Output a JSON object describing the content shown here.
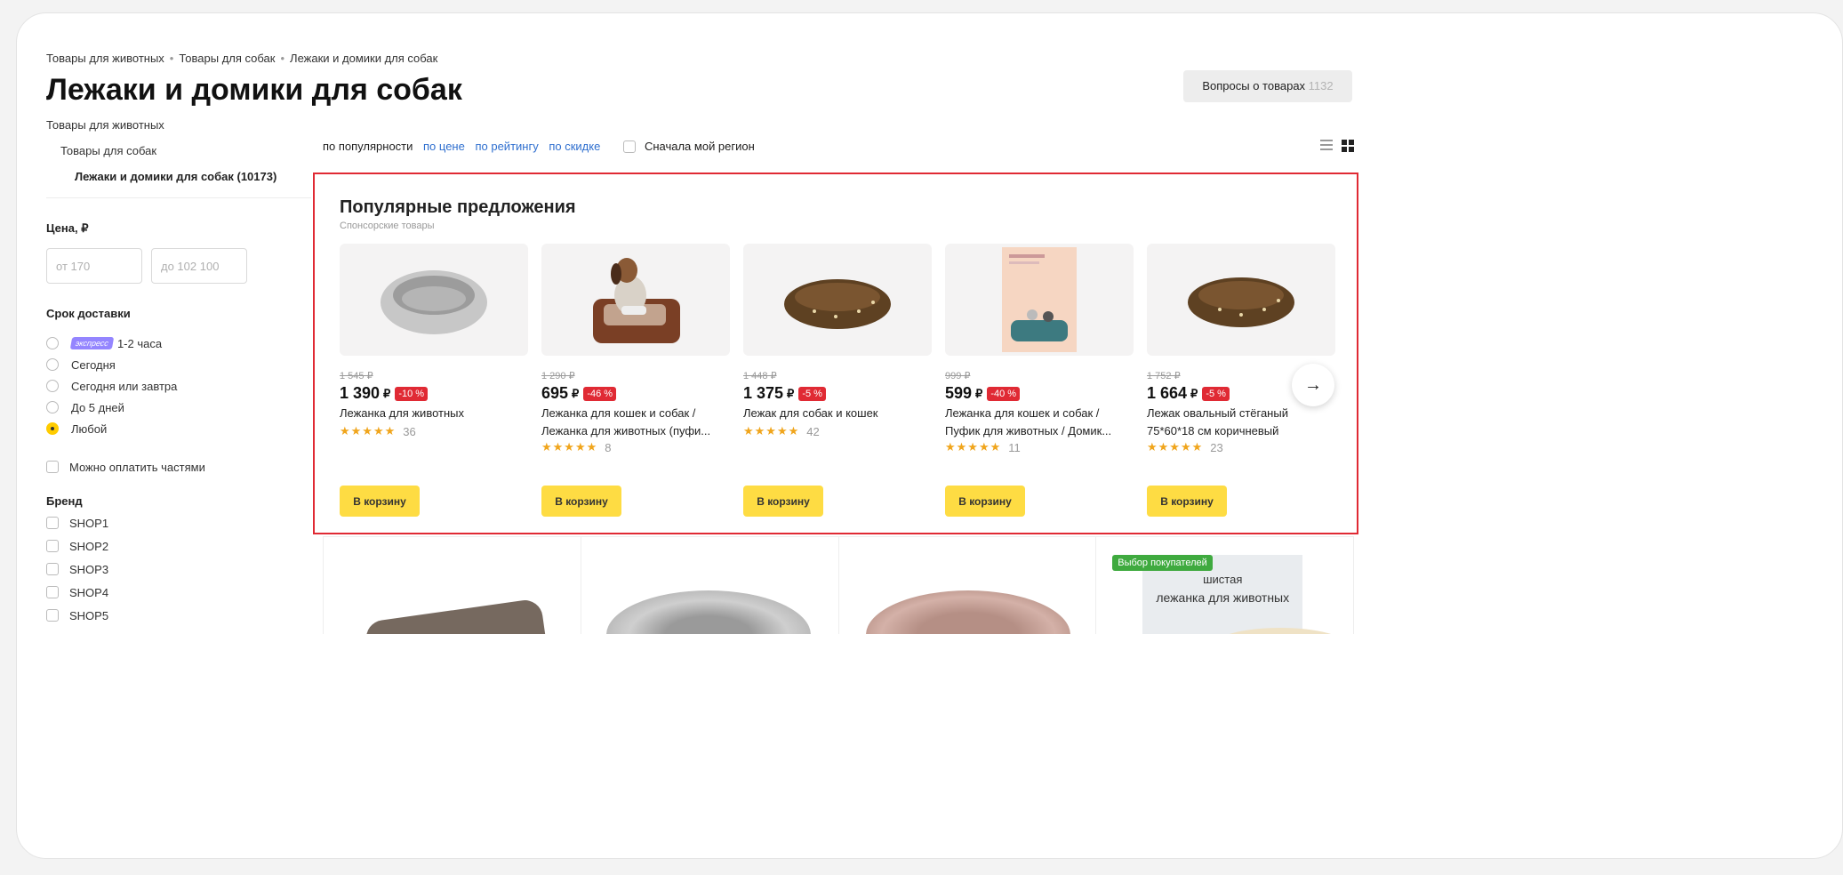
{
  "breadcrumbs": [
    "Товары для животных",
    "Товары для собак",
    "Лежаки и домики для собак"
  ],
  "page_title": "Лежаки и домики для собак",
  "questions_button": {
    "label": "Вопросы о товарах",
    "count": "1132"
  },
  "sidebar": {
    "category_root": "Товары для животных",
    "category_parent": "Товары для собак",
    "category_current": "Лежаки и домики для собак (10173)",
    "price_title": "Цена, ₽",
    "price_from_placeholder": "от 170",
    "price_to_placeholder": "до 102 100",
    "delivery_title": "Срок доставки",
    "express_badge": "экспресс",
    "delivery_options": [
      "1-2 часа",
      "Сегодня",
      "Сегодня или завтра",
      "До 5 дней",
      "Любой"
    ],
    "delivery_selected": "Любой",
    "installments_label": "Можно оплатить частями",
    "brand_title": "Бренд",
    "brands": [
      "SHOP1",
      "SHOP2",
      "SHOP3",
      "SHOP4",
      "SHOP5"
    ]
  },
  "sort": {
    "options": [
      "по популярности",
      "по цене",
      "по рейтингу",
      "по скидке"
    ],
    "active": "по популярности",
    "region_checkbox": "Сначала мой регион"
  },
  "promo": {
    "title": "Популярные предложения",
    "subtitle": "Спонсорские товары",
    "cart_label": "В корзину",
    "cards": [
      {
        "old_price": "1 545 ₽",
        "price": "1 390",
        "currency": "₽",
        "discount": "-10 %",
        "name": "Лежанка для животных",
        "stars": "★★★★★",
        "reviews": "36"
      },
      {
        "old_price": "1 290 ₽",
        "price": "695",
        "currency": "₽",
        "discount": "-46 %",
        "name": "Лежанка для кошек и собак / Лежанка для животных (пуфи...",
        "stars": "★★★★★",
        "reviews": "8"
      },
      {
        "old_price": "1 448 ₽",
        "price": "1 375",
        "currency": "₽",
        "discount": "-5 %",
        "name": "Лежак для собак и кошек",
        "stars": "★★★★★",
        "reviews": "42"
      },
      {
        "old_price": "999 ₽",
        "price": "599",
        "currency": "₽",
        "discount": "-40 %",
        "name": "Лежанка для кошек и собак / Пуфик для животных / Домик...",
        "stars": "★★★★★",
        "reviews": "11"
      },
      {
        "old_price": "1 752 ₽",
        "price": "1 664",
        "currency": "₽",
        "discount": "-5 %",
        "name": "Лежак овальный стёганый 75*60*18 см коричневый",
        "stars": "★★★★★",
        "reviews": "23"
      }
    ]
  },
  "listing": {
    "badge": "Выбор покупателей",
    "poster_line1": "шистая",
    "poster_line2": "лежанка для животных"
  },
  "colors": {
    "accent_yellow": "#fedc43",
    "discount_red": "#e02a34",
    "link_blue": "#2f6fcf",
    "badge_green": "#3faa3f"
  }
}
